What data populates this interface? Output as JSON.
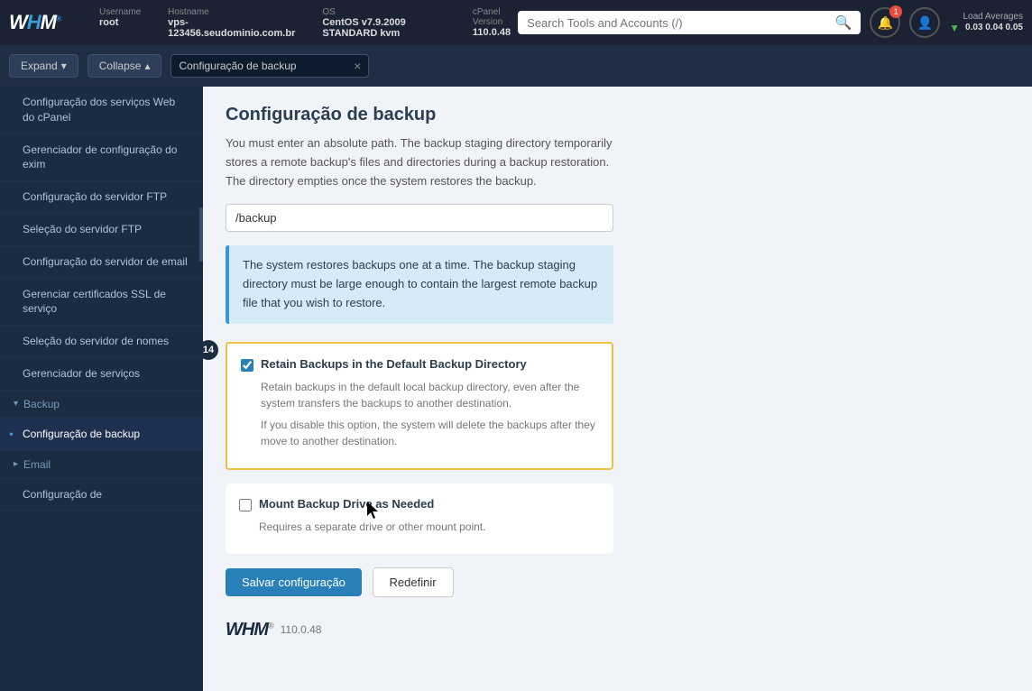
{
  "topbar": {
    "logo_text": "WHM",
    "meta": [
      {
        "label": "Username",
        "value": "root"
      },
      {
        "label": "Hostname",
        "value": "vps-123456.seudominio.com.br"
      },
      {
        "label": "OS",
        "value": "CentOS v7.9.2009 STANDARD kvm"
      },
      {
        "label": "cPanel Version",
        "value": "110.0.48"
      }
    ],
    "load_label": "Load Averages",
    "load_values": "0.03  0.04  0.05",
    "search_placeholder": "Search Tools and Accounts (/)"
  },
  "secondbar": {
    "expand_label": "Expand",
    "collapse_label": "Collapse",
    "search_filter_value": "Configuração de backup",
    "close_label": "×"
  },
  "sidebar": {
    "items": [
      {
        "label": "Configuração dos serviços Web do cPanel",
        "active": false,
        "dot": false
      },
      {
        "label": "Gerenciador de configuração do exim",
        "active": false,
        "dot": false
      },
      {
        "label": "Configuração do servidor FTP",
        "active": false,
        "dot": false
      },
      {
        "label": "Seleção do servidor FTP",
        "active": false,
        "dot": false
      },
      {
        "label": "Configuração do servidor de email",
        "active": false,
        "dot": false
      },
      {
        "label": "Gerenciar certificados SSL de serviço",
        "active": false,
        "dot": false
      },
      {
        "label": "Seleção do servidor de nomes",
        "active": false,
        "dot": false
      },
      {
        "label": "Gerenciador de serviços",
        "active": false,
        "dot": false
      }
    ],
    "section_backup": "Backup",
    "section_email": "Email",
    "backup_config_label": "Configuração de backup",
    "email_config_label": "Configuração de"
  },
  "content": {
    "page_title": "Configuração de backup",
    "intro_desc": "You must enter an absolute path. The backup staging directory temporarily stores a remote backup's files and directories during a backup restoration. The directory empties once the system restores the backup.",
    "path_value": "/backup",
    "info_box_text": "The system restores backups one at a time. The backup staging directory must be large enough to contain the largest remote backup file that you wish to restore.",
    "section14_number": "14",
    "retain_backups_label": "Retain Backups in the Default Backup Directory",
    "retain_backups_checked": true,
    "retain_backups_desc1": "Retain backups in the default local backup directory, even after the system transfers the backups to another destination.",
    "retain_backups_desc2": "If you disable this option, the system will delete the backups after they move to another destination.",
    "mount_label": "Mount Backup Drive as Needed",
    "mount_checked": false,
    "mount_desc": "Requires a separate drive or other mount point.",
    "save_label": "Salvar configuração",
    "reset_label": "Redefinir",
    "footer_version": "110.0.48"
  }
}
